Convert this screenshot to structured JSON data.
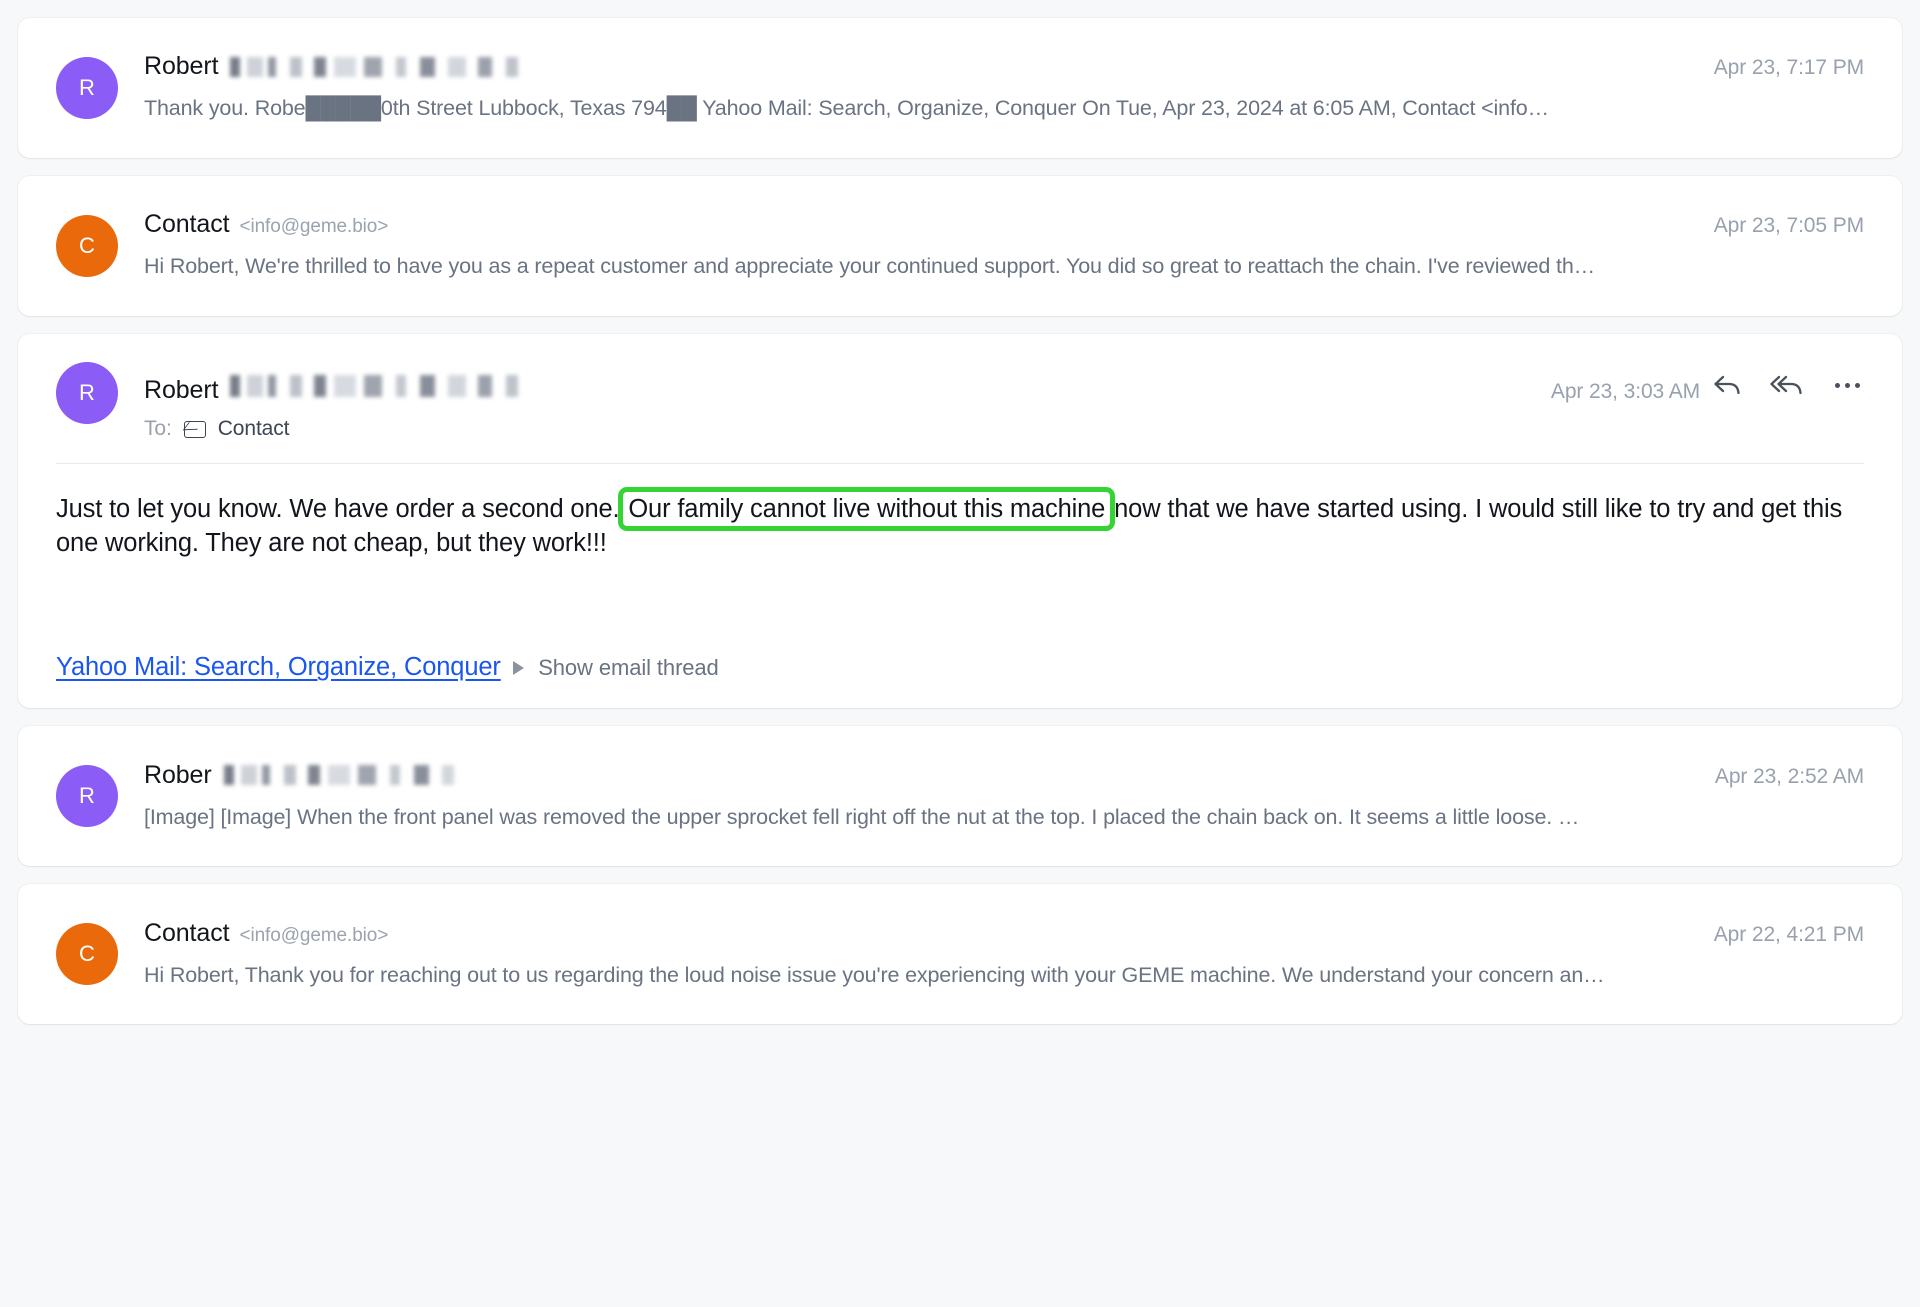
{
  "thread": {
    "messages": [
      {
        "id": "msg-1",
        "avatar_letter": "R",
        "avatar_color": "#8b5cf6",
        "sender": "Robert",
        "sender_redacted": true,
        "timestamp": "Apr 23, 7:17 PM",
        "preview": "Thank you. Robe█████0th Street Lubbock, Texas 794██ Yahoo Mail: Search, Organize, Conquer On Tue, Apr 23, 2024 at 6:05 AM, Contact <info…",
        "expanded": false
      },
      {
        "id": "msg-2",
        "avatar_letter": "C",
        "avatar_color": "#ea6a0b",
        "sender": "Contact",
        "sender_email": "<info@geme.bio>",
        "sender_redacted": false,
        "timestamp": "Apr 23, 7:05 PM",
        "preview": "Hi Robert, We're thrilled to have you as a repeat customer and appreciate your continued support. You did so great to reattach the chain. I've reviewed th…",
        "expanded": false
      },
      {
        "id": "msg-3",
        "avatar_letter": "R",
        "avatar_color": "#8b5cf6",
        "sender": "Robert",
        "sender_redacted": true,
        "timestamp": "Apr 23, 3:03 AM",
        "expanded": true,
        "to_label": "To:",
        "to_name": "Contact",
        "body_part_1": "Just to let you know. We have order a second one. ",
        "body_highlight": "Our family cannot live without this machine",
        "body_part_2": " now that we have started using. I would still like to try and get this one working. They are not cheap, but they work!!!",
        "link_text": "Yahoo Mail: Search, Organize, Conquer",
        "show_thread_label": "Show email thread",
        "highlight_color": "#35d435",
        "actions": {
          "reply": "reply-icon",
          "reply_all": "reply-all-icon",
          "more": "more-options-icon"
        }
      },
      {
        "id": "msg-4",
        "avatar_letter": "R",
        "avatar_color": "#8b5cf6",
        "sender": "Rober",
        "sender_redacted": true,
        "timestamp": "Apr 23, 2:52 AM",
        "preview": "[Image] [Image] When the front panel was removed the upper sprocket fell right off the nut at the top. I placed the chain back on. It seems a little loose. …",
        "expanded": false
      },
      {
        "id": "msg-5",
        "avatar_letter": "C",
        "avatar_color": "#ea6a0b",
        "sender": "Contact",
        "sender_email": "<info@geme.bio>",
        "sender_redacted": false,
        "timestamp": "Apr 22, 4:21 PM",
        "preview": "Hi Robert, Thank you for reaching out to us regarding the loud noise issue you're experiencing with your GEME machine. We understand your concern an…",
        "expanded": false
      }
    ]
  }
}
